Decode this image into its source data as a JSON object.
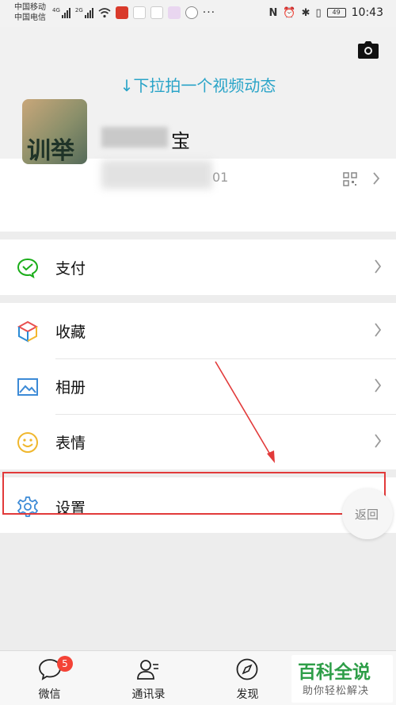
{
  "status_bar": {
    "carrier_1": "中国移动",
    "carrier_2": "中国电信",
    "net_1": "4G",
    "net_2": "2G",
    "battery": "49",
    "time": "10:43"
  },
  "header": {
    "pull_hint": "↓下拉拍一个视频动态",
    "avatar_text": "训举",
    "nickname": "宝",
    "wechat_id_tail": "01"
  },
  "menu": {
    "pay_label": "支付",
    "favorites_label": "收藏",
    "album_label": "相册",
    "stickers_label": "表情",
    "settings_label": "设置"
  },
  "floating_back": "返回",
  "tabbar": {
    "chats_label": "微信",
    "chats_badge": "5",
    "contacts_label": "通讯录",
    "discover_label": "发现"
  },
  "watermark": {
    "title": "百科全说",
    "subtitle": "助你轻松解决"
  },
  "colors": {
    "accent_blue": "#2aa4c8",
    "pay_green": "#1aad19",
    "badge_red": "#f44336",
    "annotation_red": "#e23a3a",
    "icon_blue": "#3c8ad6"
  }
}
